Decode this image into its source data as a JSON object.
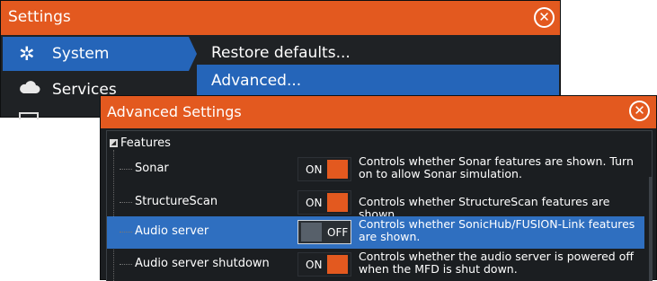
{
  "settings": {
    "title": "Settings",
    "close_icon": "close-icon",
    "sidebar": [
      {
        "label": "System",
        "icon": "gear-icon",
        "selected": true
      },
      {
        "label": "Services",
        "icon": "cloud-icon",
        "selected": false
      }
    ],
    "menu": [
      {
        "label": "Restore defaults..."
      },
      {
        "label": "Advanced...",
        "selected": true
      }
    ]
  },
  "advanced": {
    "title": "Advanced Settings",
    "close_icon": "close-icon",
    "group": "Features",
    "rows": [
      {
        "label": "Sonar",
        "state": "ON",
        "on": true,
        "description": "Controls whether Sonar features are shown. Turn on to allow Sonar simulation."
      },
      {
        "label": "StructureScan",
        "state": "ON",
        "on": true,
        "description": "Controls whether StructureScan features are shown."
      },
      {
        "label": "Audio server",
        "state": "OFF",
        "on": false,
        "selected": true,
        "description": "Controls whether SonicHub/FUSION-Link features are shown."
      },
      {
        "label": "Audio server shutdown",
        "state": "ON",
        "on": true,
        "description": "Controls whether the audio server is powered off when the MFD is shut down."
      }
    ]
  },
  "colors": {
    "accent": "#e3591f",
    "selection": "#2565b9",
    "background": "#1f2225"
  }
}
